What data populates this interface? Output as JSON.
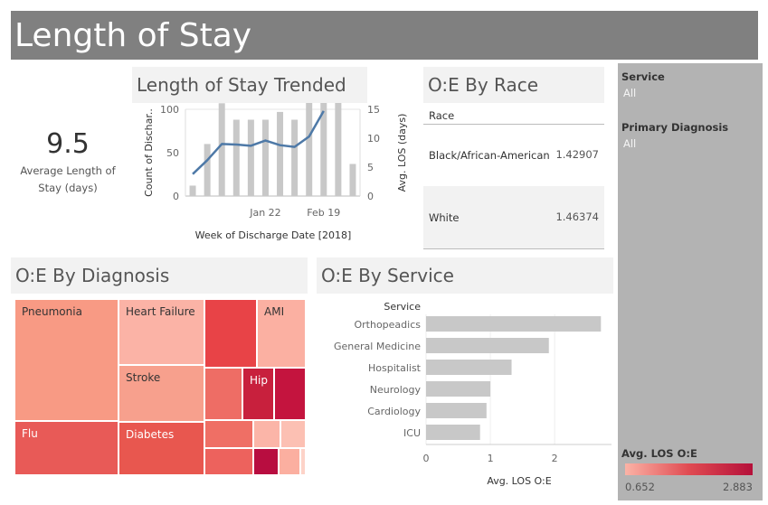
{
  "dashboard": {
    "title": "Length of Stay"
  },
  "kpi": {
    "value": "9.5",
    "label": "Average Length of Stay (days)"
  },
  "panels": {
    "trend_title": "Length of Stay Trended",
    "race_title": "O:E By Race",
    "diagnosis_title": "O:E By Diagnosis",
    "service_title": "O:E By Service"
  },
  "race_table": {
    "header": "Race",
    "rows": [
      {
        "race": "Black/African-American",
        "value": "1.42907"
      },
      {
        "race": "White",
        "value": "1.46374"
      }
    ]
  },
  "filters": {
    "service": {
      "title": "Service",
      "value": "All"
    },
    "diagnosis": {
      "title": "Primary Diagnosis",
      "value": "All"
    }
  },
  "legend": {
    "title": "Avg. LOS O:E",
    "min": "0.652",
    "max": "2.883",
    "colors": [
      "#fbb3a6",
      "#e04b52",
      "#b5103a"
    ]
  },
  "colors": {
    "bar": "#c8c8c8",
    "line": "#4e79a7",
    "header_bg": "#808080",
    "panel_title_bg": "#f2f2f2"
  },
  "chart_data": [
    {
      "type": "bar+line",
      "title": "Length of Stay Trended",
      "xlabel": "Week of Discharge Date [2018]",
      "x_ticks": [
        "Jan 22",
        "Feb 19"
      ],
      "x_ticks_at": [
        5.5,
        9.5
      ],
      "y_left": {
        "label": "Count of Dischar..",
        "ticks": [
          "100",
          "50",
          "0"
        ],
        "range": [
          0,
          100
        ]
      },
      "y_right": {
        "label": "Avg. LOS (days)",
        "ticks": [
          "15",
          "10",
          "5",
          "0"
        ],
        "range": [
          0,
          15
        ]
      },
      "series": [
        {
          "name": "Count of Discharges",
          "kind": "bar",
          "values": [
            12,
            60,
            107,
            88,
            88,
            88,
            97,
            88,
            110,
            110,
            110,
            37
          ]
        },
        {
          "name": "Avg. LOS (days)",
          "kind": "line",
          "values": [
            3.8,
            6.2,
            9.0,
            8.9,
            8.7,
            9.6,
            8.8,
            8.5,
            10.3,
            14.7
          ]
        }
      ]
    },
    {
      "type": "treemap",
      "title": "O:E By Diagnosis",
      "items": [
        {
          "name": "Pneumonia",
          "color": "#f89a84"
        },
        {
          "name": "Flu",
          "color": "#e85a57"
        },
        {
          "name": "Heart Failure",
          "color": "#fbb3a6"
        },
        {
          "name": "Stroke",
          "color": "#f7a08d"
        },
        {
          "name": "Diabetes",
          "color": "#e8574f"
        },
        {
          "name": "AMI",
          "color": "#fbb0a2"
        },
        {
          "name": "Hip",
          "color": "#c8203d"
        },
        {
          "name": "",
          "color": "#e84347"
        },
        {
          "name": "",
          "color": "#ee6d65"
        },
        {
          "name": "",
          "color": "#c4143e"
        },
        {
          "name": "",
          "color": "#ef6f65"
        },
        {
          "name": "",
          "color": "#fbb5a8"
        },
        {
          "name": "",
          "color": "#fcc0b3"
        },
        {
          "name": "",
          "color": "#ed625d"
        },
        {
          "name": "",
          "color": "#b80d40"
        },
        {
          "name": "",
          "color": "#fbafa0"
        },
        {
          "name": "",
          "color": "#fdd3c8"
        }
      ]
    },
    {
      "type": "bar",
      "title": "O:E By Service",
      "orientation": "horizontal",
      "category_header": "Service",
      "categories": [
        "Orthopeadics",
        "General Medicine",
        "Hospitalist",
        "Neurology",
        "Cardiology",
        "ICU"
      ],
      "values": [
        2.72,
        1.91,
        1.33,
        1.0,
        0.94,
        0.84
      ],
      "xlabel": "Avg. LOS O:E",
      "x_ticks": [
        "0",
        "1",
        "2"
      ],
      "xlim": [
        0,
        2.8
      ]
    }
  ]
}
